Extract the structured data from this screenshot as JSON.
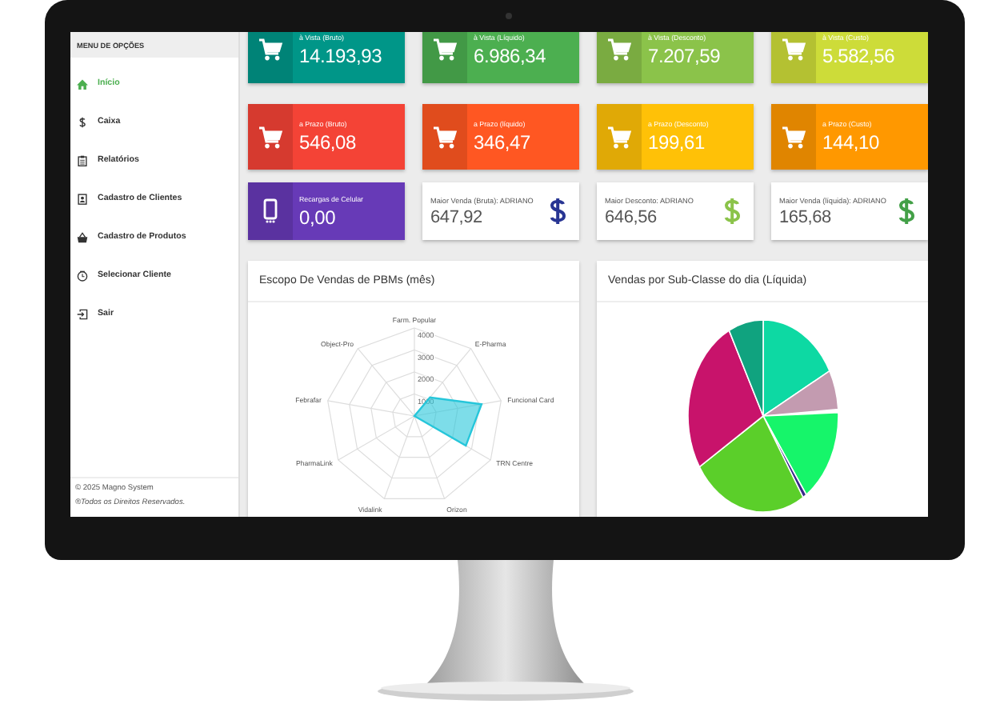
{
  "sidebar": {
    "header": "MENU DE OPÇÕES",
    "items": [
      {
        "label": "Início",
        "selected": true,
        "kind": "home"
      },
      {
        "label": "Caixa",
        "selected": false,
        "kind": "money"
      },
      {
        "label": "Relatórios",
        "selected": false,
        "kind": "report"
      },
      {
        "label": "Cadastro de Clientes",
        "selected": false,
        "kind": "contact"
      },
      {
        "label": "Cadastro de Produtos",
        "selected": false,
        "kind": "basket"
      },
      {
        "label": "Selecionar Cliente",
        "selected": false,
        "kind": "clock"
      },
      {
        "label": "Sair",
        "selected": false,
        "kind": "exit"
      }
    ],
    "footer": [
      "© 2025 Magno System",
      "®Todos os Direitos Reservados."
    ]
  },
  "tiles": [
    {
      "kind": "cart",
      "label": "à Vista (Bruto)",
      "value": "14.193,93",
      "color": "#009688"
    },
    {
      "kind": "cart",
      "label": "à Vista (Líquido)",
      "value": "6.986,34",
      "color": "#4caf50"
    },
    {
      "kind": "cart",
      "label": "à Vista (Desconto)",
      "value": "7.207,59",
      "color": "#8bc34a"
    },
    {
      "kind": "cart",
      "label": "à Vista (Custo)",
      "value": "5.582,56",
      "color": "#cddc39"
    },
    {
      "kind": "cart",
      "label": "a Prazo (Bruto)",
      "value": "546,08",
      "color": "#f44336"
    },
    {
      "kind": "cart",
      "label": "a Prazo (líquido)",
      "value": "346,47",
      "color": "#ff5722"
    },
    {
      "kind": "cart",
      "label": "a Prazo (Desconto)",
      "value": "199,61",
      "color": "#ffc107"
    },
    {
      "kind": "cart",
      "label": "a Prazo (Custo)",
      "value": "144,10",
      "color": "#ff9800"
    },
    {
      "kind": "phone",
      "label": "Recargas de Celular",
      "value": "0,00",
      "color": "#673ab7"
    },
    {
      "kind": "money",
      "label": "Maior Venda (Bruta): ADRIANO",
      "value": "647,92",
      "color": "#283593"
    },
    {
      "kind": "money",
      "label": "Maior Desconto: ADRIANO",
      "value": "646,56",
      "color": "#8bc34a"
    },
    {
      "kind": "money",
      "label": "Maior Venda (líquida): ADRIANO",
      "value": "165,68",
      "color": "#43a047"
    }
  ],
  "charts": [
    {
      "title": "Escopo De Vendas de PBMs (mês)",
      "chart_data": {
        "type": "radar",
        "categories": [
          "Farm. Popular",
          "E-Pharma",
          "Funcional Card",
          "TRN Centre",
          "Orizon",
          "Vidalink",
          "PharmaLink",
          "Febrafar",
          "Object-Pro"
        ],
        "series": [
          {
            "color": "#26c6da",
            "values": [
              0,
              1100,
              3100,
              2700,
              0,
              0,
              0,
              0,
              0
            ]
          }
        ],
        "ylim": [
          0,
          4000
        ],
        "yticks": [
          1000,
          2000,
          3000,
          4000
        ]
      }
    },
    {
      "title": "Vendas por Sub-Classe do dia (Líquida)"
    }
  ]
}
